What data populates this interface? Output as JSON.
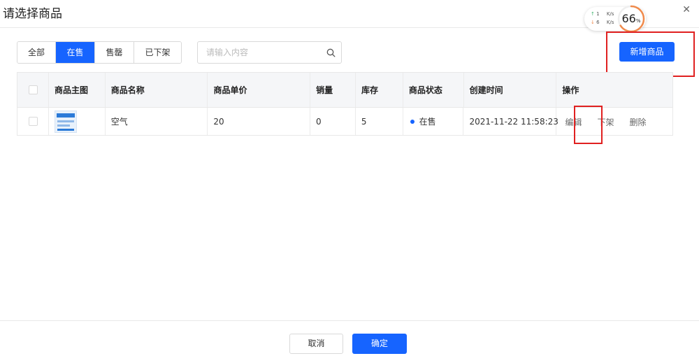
{
  "modal": {
    "title": "请选择商品",
    "close_icon": "close-icon",
    "close_glyph": "✕"
  },
  "speed_widget": {
    "up_arrow": "↑",
    "up_value": "1",
    "down_arrow": "↓",
    "down_value": "6",
    "unit": "K/s",
    "percent_value": "66",
    "percent_sign": "%",
    "percent_fraction": 0.66,
    "ring_color": "#f08a4b"
  },
  "filters": {
    "tabs": [
      {
        "label": "全部",
        "active": false
      },
      {
        "label": "在售",
        "active": true
      },
      {
        "label": "售罄",
        "active": false
      },
      {
        "label": "已下架",
        "active": false
      }
    ]
  },
  "search": {
    "placeholder": "请输入内容",
    "value": "",
    "icon": "search-icon"
  },
  "toolbar": {
    "add_label": "新增商品"
  },
  "table": {
    "headers": [
      "商品主图",
      "商品名称",
      "商品单价",
      "销量",
      "库存",
      "商品状态",
      "创建时间",
      "操作"
    ],
    "rows": [
      {
        "name": "空气",
        "price": "20",
        "sales": "0",
        "stock": "5",
        "status": "在售",
        "created": "2021-11-22 11:58:23",
        "ops": [
          "编辑",
          "下架",
          "删除"
        ]
      }
    ]
  },
  "footer": {
    "cancel_label": "取消",
    "ok_label": "确定"
  },
  "colors": {
    "primary": "#1664ff",
    "highlight_box": "#e02020",
    "status_dot": "#1664ff"
  }
}
